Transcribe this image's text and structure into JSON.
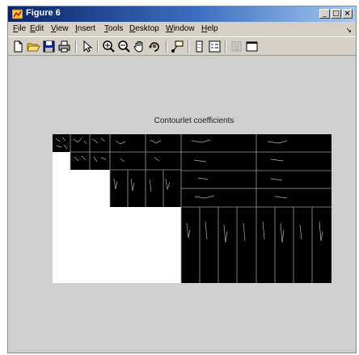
{
  "window": {
    "title": "Figure 6",
    "icon": "matlab-figure-icon",
    "controls": [
      "_",
      "□",
      "×"
    ]
  },
  "menubar": {
    "items": [
      "File",
      "Edit",
      "View",
      "Insert",
      "Tools",
      "Desktop",
      "Window",
      "Help"
    ],
    "overflow": "↘"
  },
  "toolbar": {
    "tools": [
      "new-figure-icon",
      "open-file-icon",
      "save-figure-icon",
      "print-figure-icon",
      "edit-plot-icon",
      "zoom-in-icon",
      "zoom-out-icon",
      "pan-icon",
      "rotate-3d-icon",
      "data-cursor-icon",
      "colorbar-icon",
      "legend-icon",
      "hide-plot-tools-icon",
      "show-plot-tools-icon"
    ]
  },
  "figure": {
    "axes_title": "Contourlet coefficients",
    "background": "#cfcfcf"
  }
}
